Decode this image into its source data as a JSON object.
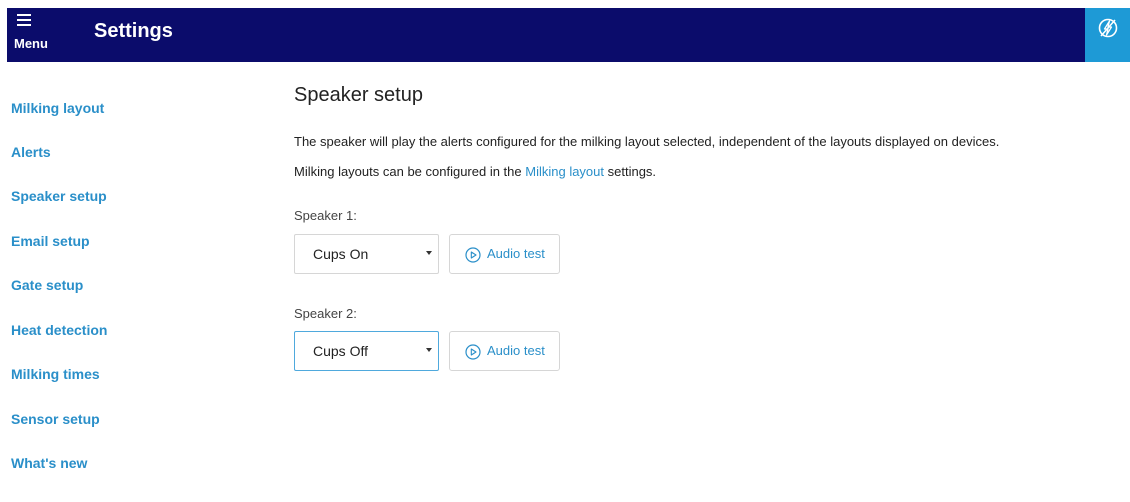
{
  "header": {
    "menu_label": "Menu",
    "title": "Settings",
    "menu_icon": "hamburger-icon",
    "action_icon": "bolt-slash-icon"
  },
  "sidebar": {
    "items": [
      {
        "label": "Milking layout"
      },
      {
        "label": "Alerts"
      },
      {
        "label": "Speaker setup"
      },
      {
        "label": "Email setup"
      },
      {
        "label": "Gate setup"
      },
      {
        "label": "Heat detection"
      },
      {
        "label": "Milking times"
      },
      {
        "label": "Sensor setup"
      },
      {
        "label": "What's new"
      }
    ]
  },
  "main": {
    "title": "Speaker setup",
    "description_line1": "The speaker will play the alerts configured for the milking layout selected, independent of the layouts displayed on devices.",
    "description_line2_prefix": "Milking layouts can be configured in the ",
    "description_line2_link": "Milking layout",
    "description_line2_suffix": " settings.",
    "speakers": [
      {
        "label": "Speaker 1:",
        "selected": "Cups On",
        "button_label": "Audio test"
      },
      {
        "label": "Speaker 2:",
        "selected": "Cups Off",
        "button_label": "Audio test"
      }
    ]
  },
  "colors": {
    "header_bg": "#0b0c6b",
    "accent": "#1e9ad6",
    "link": "#2a8fc9"
  }
}
